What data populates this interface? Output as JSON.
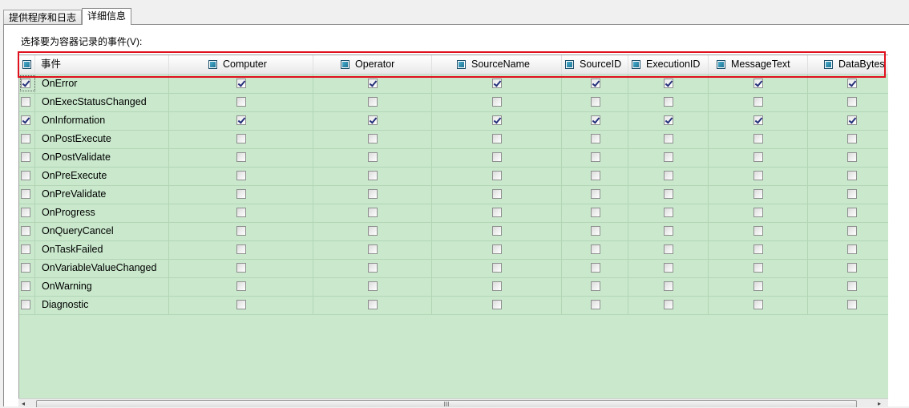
{
  "tabs": [
    {
      "label": "提供程序和日志"
    },
    {
      "label": "详细信息"
    }
  ],
  "caption": "选择要为容器记录的事件(V):",
  "columns": [
    {
      "label": "事件"
    },
    {
      "label": "Computer"
    },
    {
      "label": "Operator"
    },
    {
      "label": "SourceName"
    },
    {
      "label": "SourceID"
    },
    {
      "label": "ExecutionID"
    },
    {
      "label": "MessageText"
    },
    {
      "label": "DataBytes"
    }
  ],
  "rows": [
    {
      "event": "OnError",
      "checked": true,
      "values": [
        true,
        true,
        true,
        true,
        true,
        true,
        true
      ]
    },
    {
      "event": "OnExecStatusChanged",
      "checked": false,
      "values": [
        false,
        false,
        false,
        false,
        false,
        false,
        false
      ]
    },
    {
      "event": "OnInformation",
      "checked": true,
      "values": [
        true,
        true,
        true,
        true,
        true,
        true,
        true
      ]
    },
    {
      "event": "OnPostExecute",
      "checked": false,
      "values": [
        false,
        false,
        false,
        false,
        false,
        false,
        false
      ]
    },
    {
      "event": "OnPostValidate",
      "checked": false,
      "values": [
        false,
        false,
        false,
        false,
        false,
        false,
        false
      ]
    },
    {
      "event": "OnPreExecute",
      "checked": false,
      "values": [
        false,
        false,
        false,
        false,
        false,
        false,
        false
      ]
    },
    {
      "event": "OnPreValidate",
      "checked": false,
      "values": [
        false,
        false,
        false,
        false,
        false,
        false,
        false
      ]
    },
    {
      "event": "OnProgress",
      "checked": false,
      "values": [
        false,
        false,
        false,
        false,
        false,
        false,
        false
      ]
    },
    {
      "event": "OnQueryCancel",
      "checked": false,
      "values": [
        false,
        false,
        false,
        false,
        false,
        false,
        false
      ]
    },
    {
      "event": "OnTaskFailed",
      "checked": false,
      "values": [
        false,
        false,
        false,
        false,
        false,
        false,
        false
      ]
    },
    {
      "event": "OnVariableValueChanged",
      "checked": false,
      "values": [
        false,
        false,
        false,
        false,
        false,
        false,
        false
      ]
    },
    {
      "event": "OnWarning",
      "checked": false,
      "values": [
        false,
        false,
        false,
        false,
        false,
        false,
        false
      ]
    },
    {
      "event": "Diagnostic",
      "checked": false,
      "values": [
        false,
        false,
        false,
        false,
        false,
        false,
        false
      ]
    }
  ],
  "scrollbar": {
    "left_arrow": "◂",
    "right_arrow": "▸",
    "grip": "III"
  },
  "colors": {
    "grid_bg": "#c9e8cc",
    "highlight_border": "#e0111e",
    "check_mark": "#24307a"
  }
}
